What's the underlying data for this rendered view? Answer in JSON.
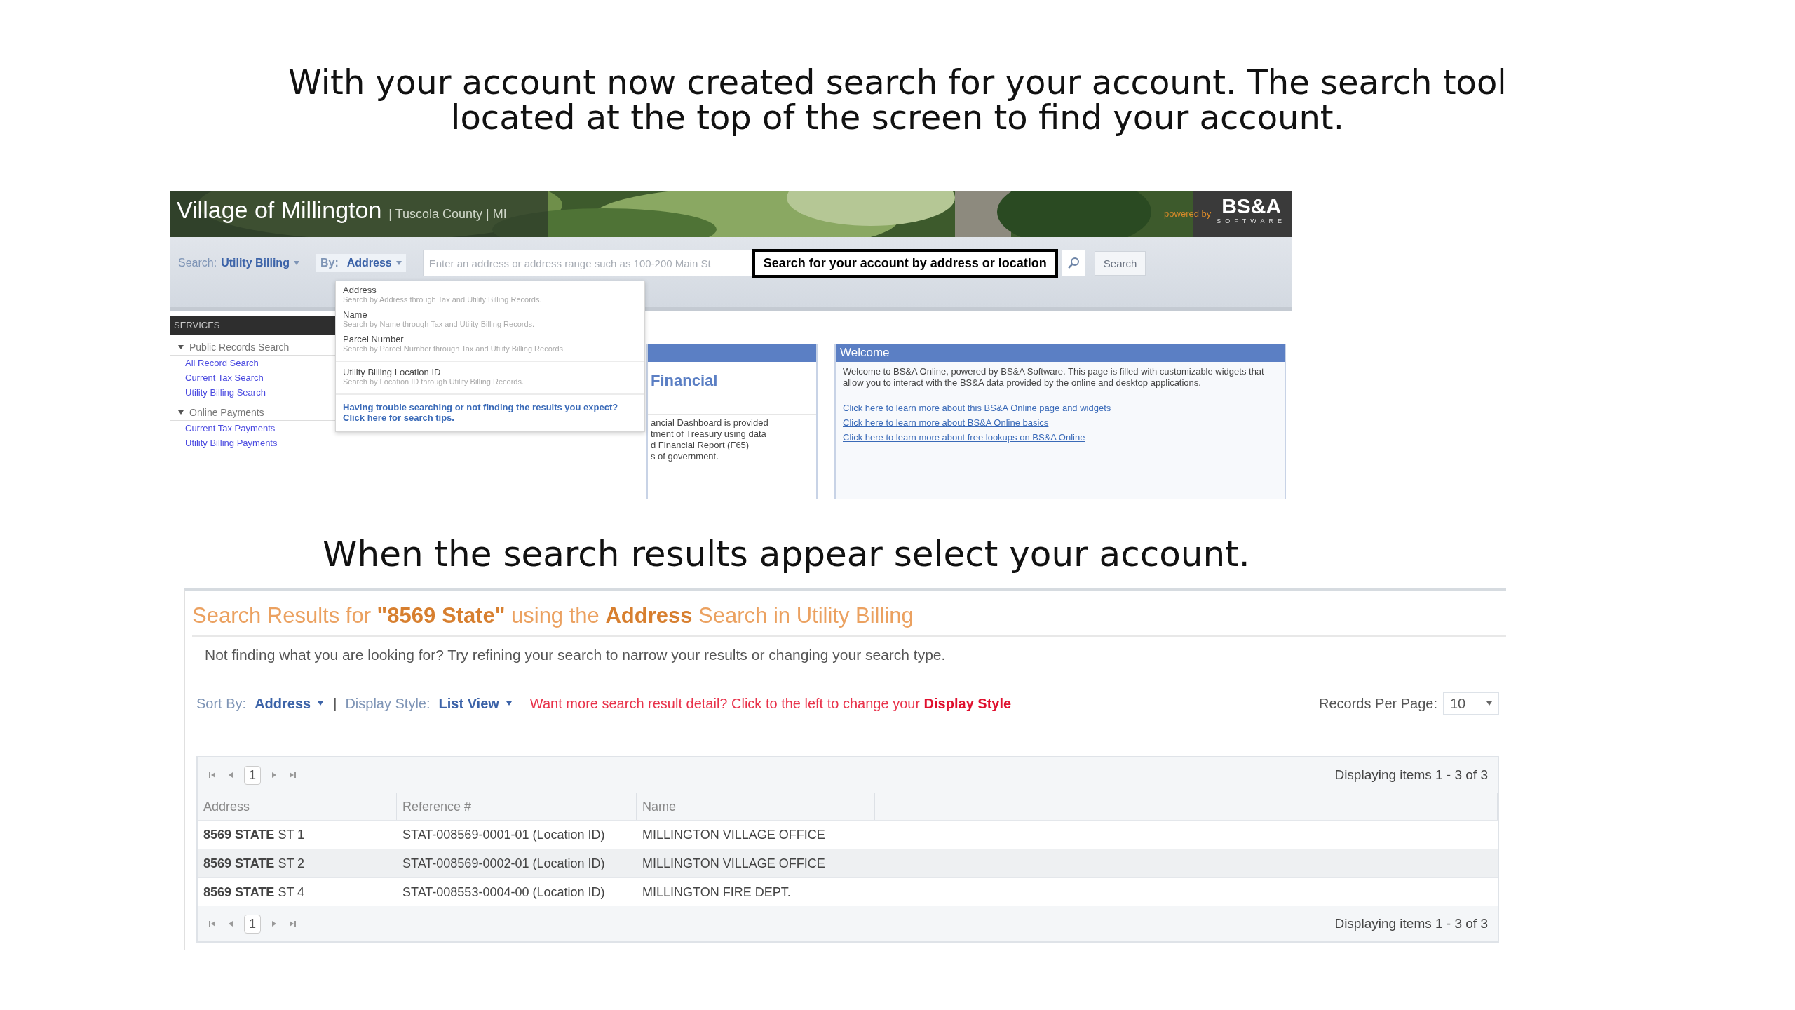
{
  "captions": [
    "With your account now created search for your account. The search tool located at the top of the screen to find your account.",
    "When the search results appear select your account."
  ],
  "portal": {
    "site_title": "Village of Millington",
    "site_subtitle": "| Tuscola County | MI",
    "powered_by": "powered by",
    "logo": "BS&A",
    "logo_sub": "SOFTWARE",
    "search_bar": {
      "search_label": "Search:",
      "search_value": "Utility Billing",
      "by_label": "By:",
      "by_value": "Address",
      "placeholder": "Enter an address or address range such as 100-200 Main St",
      "callout": "Search for your account by address or location",
      "button": "Search"
    },
    "by_menu": {
      "options": [
        {
          "title": "Address",
          "description": "Search by Address through Tax and Utility Billing Records."
        },
        {
          "title": "Name",
          "description": "Search by Name through Tax and Utility Billing Records."
        },
        {
          "title": "Parcel Number",
          "description": "Search by Parcel Number through Tax and Utility Billing Records."
        },
        {
          "title": "Utility Billing Location ID",
          "description": "Search by Location ID through Utility Billing Records."
        }
      ],
      "help_link": "Having trouble searching or not finding the results you expect? Click here for search tips."
    },
    "sidebar": {
      "header": "SERVICES",
      "groups": [
        {
          "label": "Public Records Search",
          "expanded": true,
          "links": [
            "All Record Search",
            "Current Tax Search",
            "Utility Billing Search"
          ]
        },
        {
          "label": "Online Payments",
          "expanded": true,
          "links": [
            "Current Tax Payments",
            "Utility Billing Payments"
          ]
        }
      ]
    },
    "financial_panel": {
      "title": "Financial",
      "lines": [
        "ancial Dashboard is provided",
        "tment of Treasury using data",
        "d Financial Report (F65)",
        "s of government."
      ]
    },
    "welcome_panel": {
      "title": "Welcome",
      "text": "Welcome to BS&A Online, powered by BS&A Software. This page is filled with customizable widgets that allow you to interact with the BS&A data provided by the online and desktop applications.",
      "links": [
        "Click here to learn more about this BS&A Online page and widgets",
        "Click here to learn more about BS&A Online basics",
        "Click here to learn more about free lookups on BS&A Online"
      ]
    }
  },
  "results": {
    "title": "Search Results for **\"8569 State\"** using the **Address** Search in Utility Billing",
    "hint": "Not finding what you are looking for? Try refining your search to narrow your results or changing your search type.",
    "sort_label": "Sort By:",
    "sort_value": "Address",
    "separator": "|",
    "style_label": "Display Style:",
    "style_value": "List View",
    "style_message": "Want more search result detail? Click to the left to change your **Display Style**",
    "per_page_label": "Records Per Page:",
    "per_page_value": "10",
    "pager_top": {
      "page": "1",
      "summary": "Displaying items 1 - 3 of 3"
    },
    "columns": [
      "Address",
      "Reference #",
      "Name"
    ],
    "rows": [
      {
        "address": "**8569 STATE** ST 1",
        "reference": "STAT-008569-0001-01 (Location ID)",
        "name": "MILLINGTON VILLAGE OFFICE"
      },
      {
        "address": "**8569 STATE** ST 2",
        "reference": "STAT-008569-0002-01 (Location ID)",
        "name": "MILLINGTON VILLAGE OFFICE"
      },
      {
        "address": "**8569 STATE** ST 4",
        "reference": "STAT-008553-0004-00 (Location ID)",
        "name": "MILLINGTON FIRE DEPT."
      }
    ],
    "pager_bottom": {
      "page": "1",
      "summary": "Displaying items 1 - 3 of 3"
    }
  }
}
